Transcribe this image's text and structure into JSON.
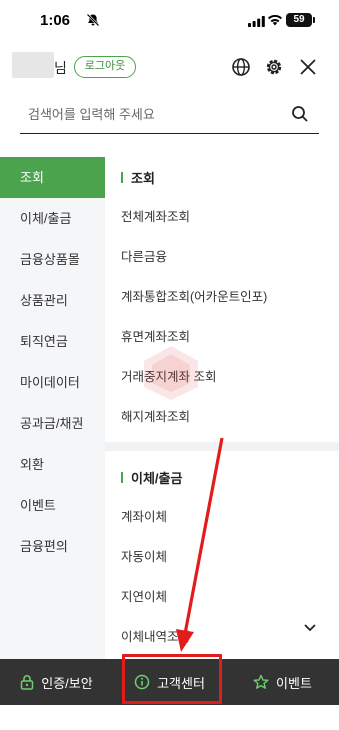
{
  "status_bar": {
    "time": "1:06",
    "battery": "59"
  },
  "header": {
    "user_suffix": "님",
    "logout_label": "로그아웃",
    "icons": [
      "bell-off-icon",
      "globe-icon",
      "gear-icon",
      "close-icon"
    ]
  },
  "search": {
    "placeholder": "검색어를 입력해 주세요"
  },
  "sidebar": {
    "items": [
      {
        "label": "조회",
        "active": true
      },
      {
        "label": "이체/출금"
      },
      {
        "label": "금융상품몰"
      },
      {
        "label": "상품관리"
      },
      {
        "label": "퇴직연금"
      },
      {
        "label": "마이데이터"
      },
      {
        "label": "공과금/채권"
      },
      {
        "label": "외환"
      },
      {
        "label": "이벤트"
      },
      {
        "label": "금융편의"
      }
    ]
  },
  "content": {
    "sections": [
      {
        "title": "조회",
        "items": [
          "전체계좌조회",
          "다른금융",
          "계좌통합조회(어카운트인포)",
          "휴면계좌조회",
          "거래중지계좌 조회",
          "해지계좌조회"
        ]
      },
      {
        "title": "이체/출금",
        "items": [
          "계좌이체",
          "자동이체",
          "지연이체",
          "이체내역조회"
        ]
      }
    ]
  },
  "bottom_bar": {
    "items": [
      {
        "label": "인증/보안",
        "icon": "lock-icon"
      },
      {
        "label": "고객센터",
        "icon": "info-icon"
      },
      {
        "label": "이벤트",
        "icon": "star-icon"
      }
    ]
  },
  "colors": {
    "accent": "#4ca34e",
    "bottom_bar": "#333333",
    "annotation": "#e21b1b"
  }
}
